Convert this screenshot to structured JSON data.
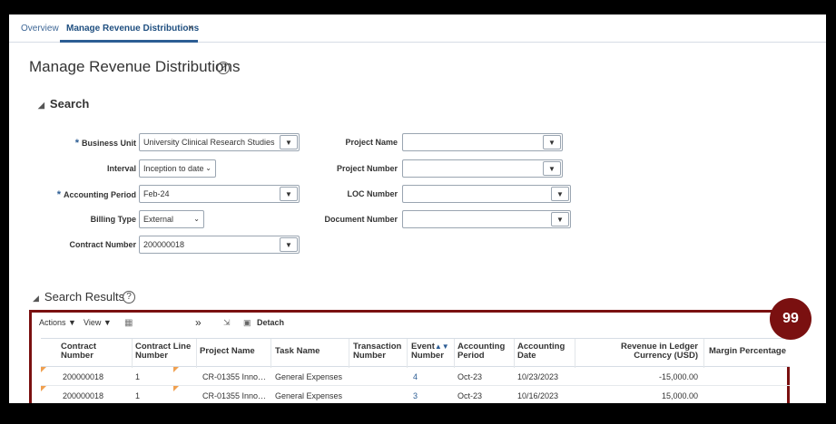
{
  "tabs": [
    {
      "label": "Overview"
    },
    {
      "label": "Manage Revenue Distributions",
      "close": "×"
    }
  ],
  "page": {
    "title": "Manage Revenue Distributions",
    "help": "?"
  },
  "search": {
    "header": "Search",
    "business_unit": {
      "label": "Business Unit",
      "value": "University Clinical Research Studies"
    },
    "interval": {
      "label": "Interval",
      "value": "Inception to date"
    },
    "accounting_period": {
      "label": "Accounting Period",
      "value": "Feb-24"
    },
    "billing_type": {
      "label": "Billing Type",
      "value": "External"
    },
    "contract_number": {
      "label": "Contract Number",
      "value": "200000018"
    },
    "project_name": {
      "label": "Project Name",
      "value": ""
    },
    "project_number": {
      "label": "Project Number",
      "value": ""
    },
    "loc_number": {
      "label": "LOC Number",
      "value": ""
    },
    "document_number": {
      "label": "Document Number",
      "value": ""
    },
    "required_marker": "*"
  },
  "results": {
    "header": "Search Results",
    "toolbar": {
      "actions": "Actions ▼",
      "view": "View ▼",
      "more": "»",
      "detach": "Detach"
    },
    "columns": {
      "contract_number": [
        "Contract",
        "Number"
      ],
      "contract_line": [
        "Contract Line",
        "Number"
      ],
      "project_name": "Project Name",
      "task_name": "Task Name",
      "transaction_number": [
        "Transaction",
        "Number"
      ],
      "event_number": [
        "Event",
        "Number"
      ],
      "accounting_period": [
        "Accounting",
        "Period"
      ],
      "accounting_date": [
        "Accounting",
        "Date"
      ],
      "revenue": [
        "Revenue in Ledger",
        "Currency (USD)"
      ],
      "margin": "Margin Percentage"
    },
    "rows": [
      {
        "contract_number": "200000018",
        "contract_line": "1",
        "project_name": "CR-01355 Inno…",
        "task_name": "General Expenses",
        "event_number": "4",
        "accounting_period": "Oct-23",
        "accounting_date": "10/23/2023",
        "revenue": "-15,000.00"
      },
      {
        "contract_number": "200000018",
        "contract_line": "1",
        "project_name": "CR-01355 Inno…",
        "task_name": "General Expenses",
        "event_number": "3",
        "accounting_period": "Oct-23",
        "accounting_date": "10/16/2023",
        "revenue": "15,000.00"
      }
    ]
  },
  "badge": {
    "value": "99",
    "color": "#7a1010"
  },
  "colors": {
    "accent": "#2c5d94",
    "highlight_border": "#7a1010",
    "row_flag": "#f0a050"
  }
}
